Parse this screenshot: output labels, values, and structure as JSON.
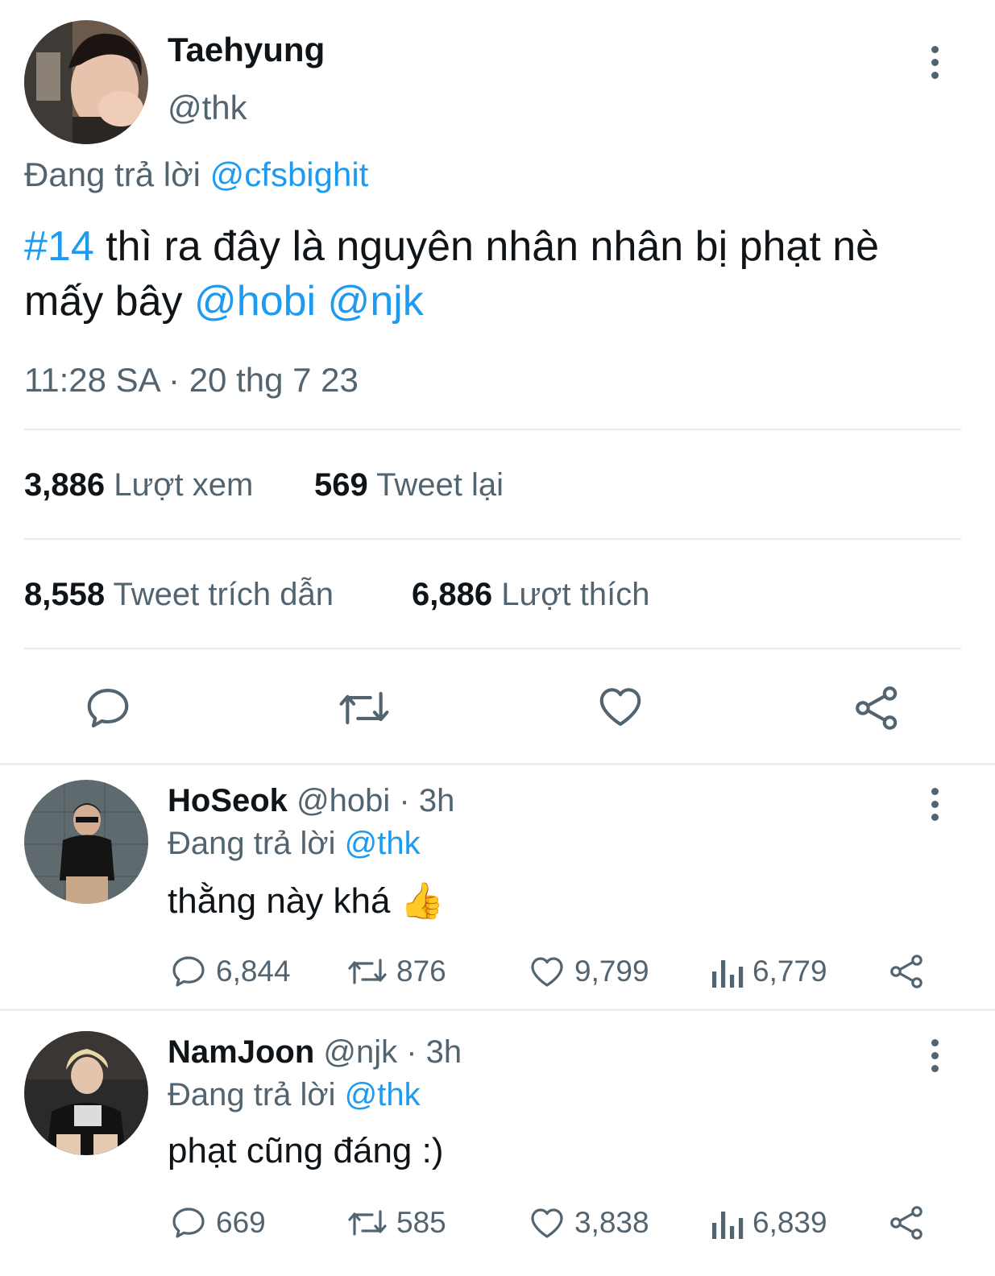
{
  "main_tweet": {
    "display_name": "Taehyung",
    "handle": "@thk",
    "reply_prefix": "Đang trả lời",
    "reply_to": "@cfsbighit",
    "hashtag": "#14",
    "text_line1": " thì ra đây là nguyên nhân nhân bị phạt nè",
    "text_line2_prefix": "mấy bây ",
    "mention1": "@hobi",
    "mention2": "@njk",
    "timestamp": "11:28 SA · 20 thg 7 23",
    "stats": {
      "views_count": "3,886",
      "views_label": "Lượt xem",
      "retweets_count": "569",
      "retweets_label": "Tweet lại",
      "quotes_count": "8,558",
      "quotes_label": "Tweet trích dẫn",
      "likes_count": "6,886",
      "likes_label": "Lượt thích"
    },
    "actions": [
      "reply-icon",
      "retweet-icon",
      "like-icon",
      "share-icon"
    ]
  },
  "replies": [
    {
      "display_name": "HoSeok",
      "handle": "@hobi",
      "time": "· 3h",
      "reply_prefix": "Đang trả lời",
      "reply_to": "@thk",
      "text": "thằng này khá",
      "emoji": "👍",
      "reply_count": "6,844",
      "retweet_count": "876",
      "like_count": "9,799",
      "view_count": "6,779"
    },
    {
      "display_name": "NamJoon",
      "handle": "@njk",
      "time": "· 3h",
      "reply_prefix": "Đang trả lời",
      "reply_to": "@thk",
      "text": "phạt cũng đáng :)",
      "reply_count": "669",
      "retweet_count": "585",
      "like_count": "3,838",
      "view_count": "6,839"
    }
  ],
  "colors": {
    "accent": "#1d9bf0",
    "text": "#0f1419",
    "secondary": "#536471",
    "divider": "#e9ecef"
  }
}
